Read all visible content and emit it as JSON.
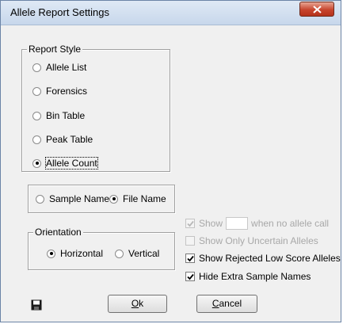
{
  "window": {
    "title": "Allele Report Settings",
    "close_glyph": "X"
  },
  "report_style": {
    "label": "Report Style",
    "options": [
      {
        "label": "Allele List",
        "selected": false
      },
      {
        "label": "Forensics",
        "selected": false
      },
      {
        "label": "Bin Table",
        "selected": false
      },
      {
        "label": "Peak Table",
        "selected": false
      },
      {
        "label": "Allele Count",
        "selected": true
      }
    ]
  },
  "name_source": {
    "options": [
      {
        "label": "Sample Name",
        "selected": false
      },
      {
        "label": "File Name",
        "selected": true
      }
    ]
  },
  "orientation": {
    "label": "Orientation",
    "options": [
      {
        "label": "Horizontal",
        "selected": true
      },
      {
        "label": "Vertical",
        "selected": false
      }
    ]
  },
  "options": {
    "show_when": {
      "label_before": "Show",
      "input_value": "",
      "label_after": "when no allele call",
      "checked": true,
      "enabled": false
    },
    "show_uncertain": {
      "label": "Show Only Uncertain Alleles",
      "checked": false,
      "enabled": false
    },
    "show_rejected": {
      "label": "Show Rejected Low Score Alleles",
      "checked": true,
      "enabled": true
    },
    "hide_extra": {
      "label": "Hide Extra Sample Names",
      "checked": true,
      "enabled": true
    }
  },
  "buttons": {
    "ok_accel": "O",
    "ok_rest": "k",
    "cancel_accel": "C",
    "cancel_rest": "ancel"
  },
  "icons": {
    "save": "save-icon",
    "close": "close-icon"
  }
}
